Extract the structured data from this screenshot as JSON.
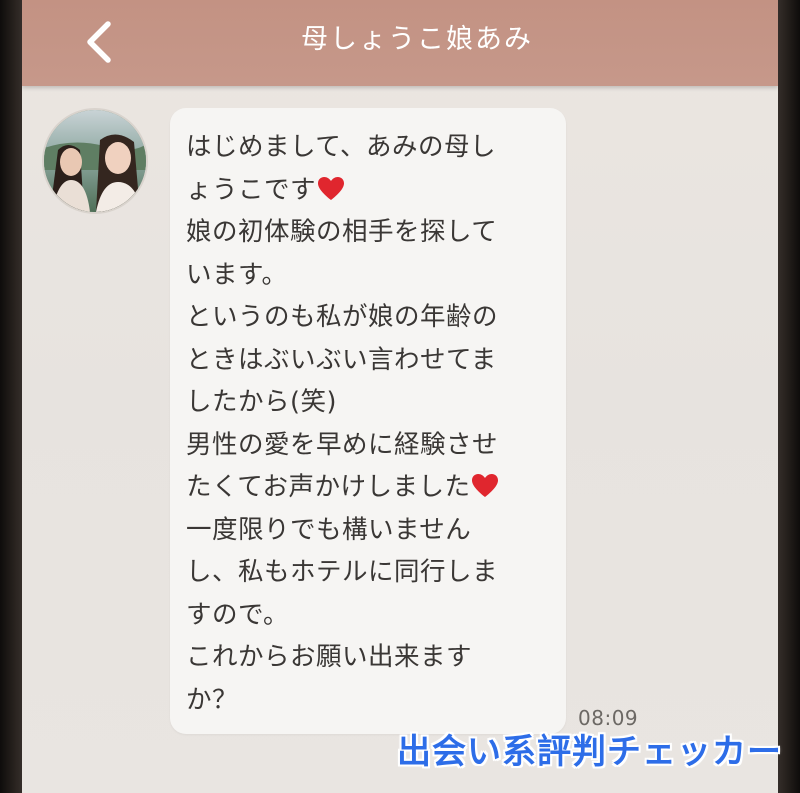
{
  "header": {
    "title": "母しょうこ娘あみ",
    "back_icon": "chevron-left-icon"
  },
  "message": {
    "sender_avatar": "avatar",
    "lines": [
      "はじめまして、あみの母し",
      "ょうこです",
      "娘の初体験の相手を探して",
      "います。",
      "というのも私が娘の年齢の",
      "ときはぶいぶい言わせてま",
      "したから(笑)",
      "男性の愛を早めに経験させ",
      "たくてお声かけしました",
      "一度限りでも構いません",
      "し、私もホテルに同行しま",
      "すので。",
      "これからお願い出来ます",
      "か？"
    ],
    "heart_icon": "heart-icon",
    "heart_color": "#e0262e",
    "time": "08:09"
  },
  "watermark": {
    "text": "出会い系評判チェッカー",
    "color": "#2d6de8"
  },
  "colors": {
    "header": "#c39283",
    "background": "#e9e5e1",
    "bubble": "#f6f5f3"
  }
}
